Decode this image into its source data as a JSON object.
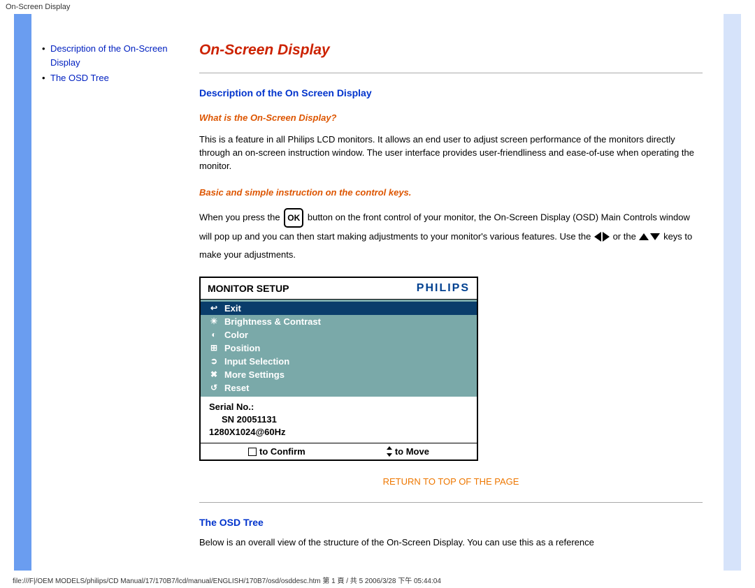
{
  "browser_title": "On-Screen Display",
  "sidebar": {
    "items": [
      {
        "label": "Description of the On-Screen Display"
      },
      {
        "label": "The OSD Tree"
      }
    ]
  },
  "main": {
    "title": "On-Screen Display",
    "section1": {
      "heading": "Description of the On Screen Display",
      "q1": "What is the On-Screen Display?",
      "p1": "This is a feature in all Philips LCD monitors. It allows an end user to adjust screen performance of the monitors directly through an on-screen instruction window. The user interface provides user-friendliness and ease-of-use when operating the monitor.",
      "q2": "Basic and simple instruction on the control keys.",
      "p2a": "When you press the ",
      "p2_ok": "OK",
      "p2b": " button on the front control of your monitor, the On-Screen Display (OSD) Main Controls window will pop up and you can then start making adjustments to your monitor's various features. Use the ",
      "p2c": " or the ",
      "p2d": " keys to make your adjustments."
    },
    "osd": {
      "header_title": "MONITOR SETUP",
      "brand": "PHILIPS",
      "menu": [
        {
          "icon": "↩",
          "label": "Exit",
          "selected": true
        },
        {
          "icon": "☀",
          "label": "Brightness & Contrast",
          "selected": false
        },
        {
          "icon": "◐",
          "label": "Color",
          "selected": false
        },
        {
          "icon": "⊞",
          "label": "Position",
          "selected": false
        },
        {
          "icon": "➲",
          "label": "Input Selection",
          "selected": false
        },
        {
          "icon": "✖",
          "label": "More Settings",
          "selected": false
        },
        {
          "icon": "↺",
          "label": "Reset",
          "selected": false
        }
      ],
      "serial_label": "Serial No.:",
      "serial_value": "SN 20051131",
      "resolution": "1280X1024@60Hz",
      "confirm_label": "to Confirm",
      "move_label": "to Move"
    },
    "return_link": "RETURN TO TOP OF THE PAGE",
    "section2": {
      "heading": "The OSD Tree",
      "p1": "Below is an overall view of the structure of the On-Screen Display. You can use this as a reference"
    }
  },
  "footer_path": "file:///F|/OEM MODELS/philips/CD Manual/17/170B7/lcd/manual/ENGLISH/170B7/osd/osddesc.htm 第 1 頁 / 共 5 2006/3/28 下午 05:44:04"
}
